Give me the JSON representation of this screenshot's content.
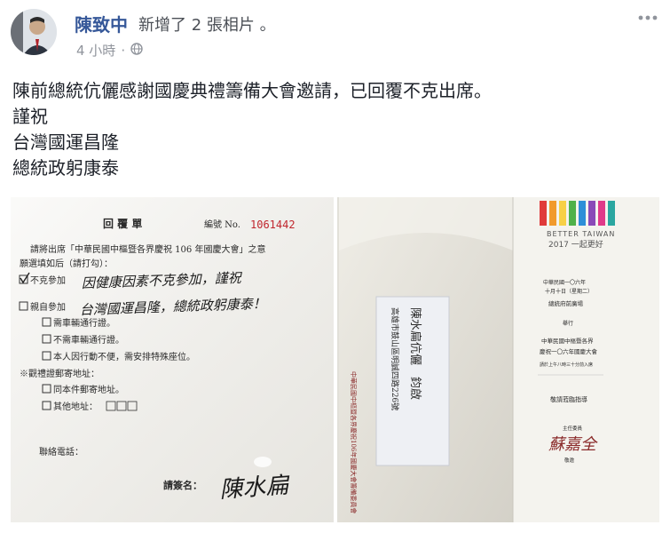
{
  "post": {
    "author": "陳致中",
    "action": "新增了 2 張相片 。",
    "time": "4 小時",
    "separator": "·",
    "privacy_icon": "globe-icon",
    "more_icon": "ellipsis-icon",
    "lines": [
      "陳前總統伉儷感謝國慶典禮籌備大會邀請，已回覆不克出席。",
      "謹祝",
      "台灣國運昌隆",
      "總統政躬康泰"
    ]
  },
  "reply_card": {
    "title": "回  覆  單",
    "serial_label": "編號 No.",
    "serial_number": "1061442",
    "intro_line1": "請將出席「中華民國中樞暨各界慶祝 106 年國慶大會」之意",
    "intro_line2": "願選填如后（請打勾）：",
    "option_decline": "不克參加",
    "option_attend": "親自參加",
    "sub_options": [
      "需車輛通行證。",
      "不需車輛通行證。",
      "本人因行動不便，需安排特殊座位。"
    ],
    "mail_label": "※觀禮證郵寄地址：",
    "mail_options": [
      "同本件郵寄地址。",
      "其他地址："
    ],
    "phone_label": "聯絡電話：",
    "signature_label": "請簽名：",
    "handwriting_line1": "因健康因素不克參加，謹祝",
    "handwriting_line2": "台灣國運昌隆，總統政躬康泰！",
    "signature": "陳水扁"
  },
  "envelope": {
    "address": "高雄市鼓山區明誠四路226號",
    "recipient": "陳水扁伉儷　鈞啟",
    "side_text": "中華民國中樞暨各界慶祝106年國慶大會籌備委員會",
    "brand": "BETTER TAIWAN",
    "brand_sub": "2017 一起更好",
    "event_date": "中華民國一〇六年",
    "event_day": "十月十日（星期二）",
    "event_place": "總統府前廣場",
    "host_label": "舉行",
    "event_name1": "中華民國中樞暨各界",
    "event_name2": "慶祝一〇六年國慶大會",
    "event_note": "請於上午八時三十分前入席",
    "closing": "敬請蒞臨指導",
    "organizer_label": "主任委員",
    "organizer": "蘇嘉全",
    "organizer_tail": "敬邀",
    "stripe_colors": [
      "#e03a3a",
      "#f19a2c",
      "#f7d046",
      "#4fb14a",
      "#2e8fd8",
      "#8a4ab8",
      "#e03a8a",
      "#2aa6a0"
    ]
  }
}
